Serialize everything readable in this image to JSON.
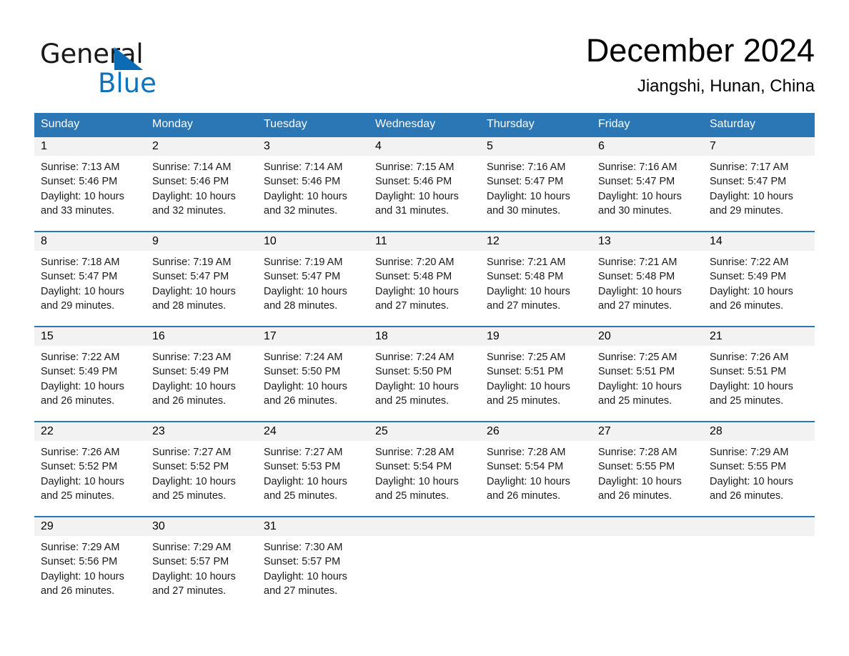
{
  "brand": {
    "name_part1": "General",
    "name_part2": "Blue",
    "triangle_color": "#0b6cb5",
    "blue_text_color": "#0f72bd"
  },
  "header": {
    "month_title": "December 2024",
    "location": "Jiangshi, Hunan, China"
  },
  "theme": {
    "header_blue": "#2b76b5",
    "day_band_gray": "#f2f2f2",
    "text_black": "#000000"
  },
  "weekdays": [
    "Sunday",
    "Monday",
    "Tuesday",
    "Wednesday",
    "Thursday",
    "Friday",
    "Saturday"
  ],
  "weeks": [
    [
      {
        "day": "1",
        "sunrise": "Sunrise: 7:13 AM",
        "sunset": "Sunset: 5:46 PM",
        "daylight1": "Daylight: 10 hours",
        "daylight2": "and 33 minutes."
      },
      {
        "day": "2",
        "sunrise": "Sunrise: 7:14 AM",
        "sunset": "Sunset: 5:46 PM",
        "daylight1": "Daylight: 10 hours",
        "daylight2": "and 32 minutes."
      },
      {
        "day": "3",
        "sunrise": "Sunrise: 7:14 AM",
        "sunset": "Sunset: 5:46 PM",
        "daylight1": "Daylight: 10 hours",
        "daylight2": "and 32 minutes."
      },
      {
        "day": "4",
        "sunrise": "Sunrise: 7:15 AM",
        "sunset": "Sunset: 5:46 PM",
        "daylight1": "Daylight: 10 hours",
        "daylight2": "and 31 minutes."
      },
      {
        "day": "5",
        "sunrise": "Sunrise: 7:16 AM",
        "sunset": "Sunset: 5:47 PM",
        "daylight1": "Daylight: 10 hours",
        "daylight2": "and 30 minutes."
      },
      {
        "day": "6",
        "sunrise": "Sunrise: 7:16 AM",
        "sunset": "Sunset: 5:47 PM",
        "daylight1": "Daylight: 10 hours",
        "daylight2": "and 30 minutes."
      },
      {
        "day": "7",
        "sunrise": "Sunrise: 7:17 AM",
        "sunset": "Sunset: 5:47 PM",
        "daylight1": "Daylight: 10 hours",
        "daylight2": "and 29 minutes."
      }
    ],
    [
      {
        "day": "8",
        "sunrise": "Sunrise: 7:18 AM",
        "sunset": "Sunset: 5:47 PM",
        "daylight1": "Daylight: 10 hours",
        "daylight2": "and 29 minutes."
      },
      {
        "day": "9",
        "sunrise": "Sunrise: 7:19 AM",
        "sunset": "Sunset: 5:47 PM",
        "daylight1": "Daylight: 10 hours",
        "daylight2": "and 28 minutes."
      },
      {
        "day": "10",
        "sunrise": "Sunrise: 7:19 AM",
        "sunset": "Sunset: 5:47 PM",
        "daylight1": "Daylight: 10 hours",
        "daylight2": "and 28 minutes."
      },
      {
        "day": "11",
        "sunrise": "Sunrise: 7:20 AM",
        "sunset": "Sunset: 5:48 PM",
        "daylight1": "Daylight: 10 hours",
        "daylight2": "and 27 minutes."
      },
      {
        "day": "12",
        "sunrise": "Sunrise: 7:21 AM",
        "sunset": "Sunset: 5:48 PM",
        "daylight1": "Daylight: 10 hours",
        "daylight2": "and 27 minutes."
      },
      {
        "day": "13",
        "sunrise": "Sunrise: 7:21 AM",
        "sunset": "Sunset: 5:48 PM",
        "daylight1": "Daylight: 10 hours",
        "daylight2": "and 27 minutes."
      },
      {
        "day": "14",
        "sunrise": "Sunrise: 7:22 AM",
        "sunset": "Sunset: 5:49 PM",
        "daylight1": "Daylight: 10 hours",
        "daylight2": "and 26 minutes."
      }
    ],
    [
      {
        "day": "15",
        "sunrise": "Sunrise: 7:22 AM",
        "sunset": "Sunset: 5:49 PM",
        "daylight1": "Daylight: 10 hours",
        "daylight2": "and 26 minutes."
      },
      {
        "day": "16",
        "sunrise": "Sunrise: 7:23 AM",
        "sunset": "Sunset: 5:49 PM",
        "daylight1": "Daylight: 10 hours",
        "daylight2": "and 26 minutes."
      },
      {
        "day": "17",
        "sunrise": "Sunrise: 7:24 AM",
        "sunset": "Sunset: 5:50 PM",
        "daylight1": "Daylight: 10 hours",
        "daylight2": "and 26 minutes."
      },
      {
        "day": "18",
        "sunrise": "Sunrise: 7:24 AM",
        "sunset": "Sunset: 5:50 PM",
        "daylight1": "Daylight: 10 hours",
        "daylight2": "and 25 minutes."
      },
      {
        "day": "19",
        "sunrise": "Sunrise: 7:25 AM",
        "sunset": "Sunset: 5:51 PM",
        "daylight1": "Daylight: 10 hours",
        "daylight2": "and 25 minutes."
      },
      {
        "day": "20",
        "sunrise": "Sunrise: 7:25 AM",
        "sunset": "Sunset: 5:51 PM",
        "daylight1": "Daylight: 10 hours",
        "daylight2": "and 25 minutes."
      },
      {
        "day": "21",
        "sunrise": "Sunrise: 7:26 AM",
        "sunset": "Sunset: 5:51 PM",
        "daylight1": "Daylight: 10 hours",
        "daylight2": "and 25 minutes."
      }
    ],
    [
      {
        "day": "22",
        "sunrise": "Sunrise: 7:26 AM",
        "sunset": "Sunset: 5:52 PM",
        "daylight1": "Daylight: 10 hours",
        "daylight2": "and 25 minutes."
      },
      {
        "day": "23",
        "sunrise": "Sunrise: 7:27 AM",
        "sunset": "Sunset: 5:52 PM",
        "daylight1": "Daylight: 10 hours",
        "daylight2": "and 25 minutes."
      },
      {
        "day": "24",
        "sunrise": "Sunrise: 7:27 AM",
        "sunset": "Sunset: 5:53 PM",
        "daylight1": "Daylight: 10 hours",
        "daylight2": "and 25 minutes."
      },
      {
        "day": "25",
        "sunrise": "Sunrise: 7:28 AM",
        "sunset": "Sunset: 5:54 PM",
        "daylight1": "Daylight: 10 hours",
        "daylight2": "and 25 minutes."
      },
      {
        "day": "26",
        "sunrise": "Sunrise: 7:28 AM",
        "sunset": "Sunset: 5:54 PM",
        "daylight1": "Daylight: 10 hours",
        "daylight2": "and 26 minutes."
      },
      {
        "day": "27",
        "sunrise": "Sunrise: 7:28 AM",
        "sunset": "Sunset: 5:55 PM",
        "daylight1": "Daylight: 10 hours",
        "daylight2": "and 26 minutes."
      },
      {
        "day": "28",
        "sunrise": "Sunrise: 7:29 AM",
        "sunset": "Sunset: 5:55 PM",
        "daylight1": "Daylight: 10 hours",
        "daylight2": "and 26 minutes."
      }
    ],
    [
      {
        "day": "29",
        "sunrise": "Sunrise: 7:29 AM",
        "sunset": "Sunset: 5:56 PM",
        "daylight1": "Daylight: 10 hours",
        "daylight2": "and 26 minutes."
      },
      {
        "day": "30",
        "sunrise": "Sunrise: 7:29 AM",
        "sunset": "Sunset: 5:57 PM",
        "daylight1": "Daylight: 10 hours",
        "daylight2": "and 27 minutes."
      },
      {
        "day": "31",
        "sunrise": "Sunrise: 7:30 AM",
        "sunset": "Sunset: 5:57 PM",
        "daylight1": "Daylight: 10 hours",
        "daylight2": "and 27 minutes."
      },
      {
        "day": "",
        "sunrise": "",
        "sunset": "",
        "daylight1": "",
        "daylight2": ""
      },
      {
        "day": "",
        "sunrise": "",
        "sunset": "",
        "daylight1": "",
        "daylight2": ""
      },
      {
        "day": "",
        "sunrise": "",
        "sunset": "",
        "daylight1": "",
        "daylight2": ""
      },
      {
        "day": "",
        "sunrise": "",
        "sunset": "",
        "daylight1": "",
        "daylight2": ""
      }
    ]
  ]
}
